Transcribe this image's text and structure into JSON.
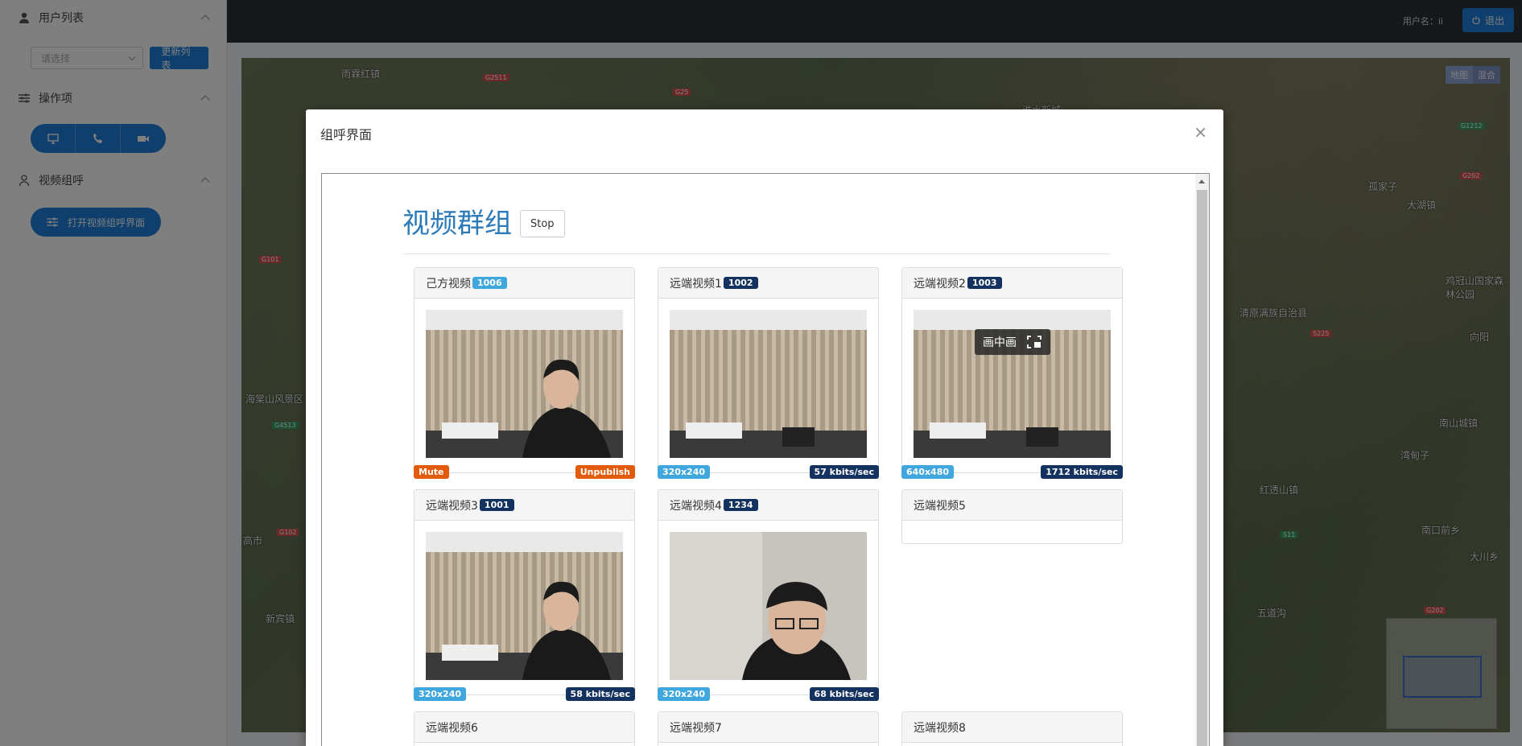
{
  "sidebar": {
    "user_list": {
      "title": "用户列表",
      "select_placeholder": "请选择",
      "refresh_label": "更新列表"
    },
    "operations": {
      "title": "操作项",
      "buttons": [
        "monitor-icon",
        "phone-icon",
        "camera-icon"
      ]
    },
    "video_group": {
      "title": "视频组呼",
      "open_label": "打开视频组呼界面"
    }
  },
  "topbar": {
    "username_label": "用户名：ii",
    "logout_label": "退出"
  },
  "map": {
    "type_map": "地图",
    "type_hybrid": "混合",
    "labels": [
      "雨霖红镇",
      "海棠山风景区",
      "淮水新城",
      "大湖镇",
      "鸡冠山国家森林公园",
      "清原满族自治县",
      "向阳",
      "南山城镇",
      "红透山镇",
      "湾甸子",
      "南口前乡",
      "大川乡",
      "五道沟",
      "高市",
      "新宾镇",
      "孤家子"
    ],
    "roads": [
      "G2511",
      "G25",
      "G1212",
      "G202",
      "G101",
      "G4513",
      "G102",
      "S225",
      "S11",
      "G202"
    ]
  },
  "modal": {
    "title": "组呼界面",
    "close": "×",
    "group_title": "视频群组",
    "stop_label": "Stop",
    "panels": [
      {
        "title": "己方视频",
        "badge": "1006",
        "badge_style": "light",
        "left_tag": "Mute",
        "right_tag": "Unpublish",
        "tag_style": "orange",
        "has_video": true,
        "face": "a"
      },
      {
        "title": "远端视频1",
        "badge": "1002",
        "badge_style": "dark",
        "left_tag": "320x240",
        "right_tag": "57 kbits/sec",
        "tag_style": "stats",
        "has_video": true,
        "face": "none"
      },
      {
        "title": "远端视频2",
        "badge": "1003",
        "badge_style": "dark",
        "left_tag": "640x480",
        "right_tag": "1712 kbits/sec",
        "tag_style": "stats",
        "has_video": true,
        "face": "none",
        "pip_label": "画中画"
      },
      {
        "title": "远端视频3",
        "badge": "1001",
        "badge_style": "dark",
        "left_tag": "320x240",
        "right_tag": "58 kbits/sec",
        "tag_style": "stats",
        "has_video": true,
        "face": "a"
      },
      {
        "title": "远端视频4",
        "badge": "1234",
        "badge_style": "dark",
        "left_tag": "320x240",
        "right_tag": "68 kbits/sec",
        "tag_style": "stats",
        "has_video": true,
        "face": "b"
      },
      {
        "title": "远端视频5",
        "badge": "",
        "has_video": false
      },
      {
        "title": "远端视频6",
        "badge": "",
        "has_video": false
      },
      {
        "title": "远端视频7",
        "badge": "",
        "has_video": false
      },
      {
        "title": "远端视频8",
        "badge": "",
        "has_video": false
      }
    ]
  }
}
